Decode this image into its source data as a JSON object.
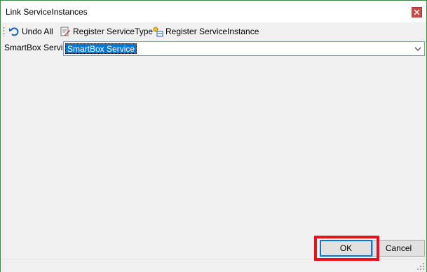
{
  "window": {
    "title": "Link ServiceInstances"
  },
  "icons": {
    "close": "close-icon",
    "undo": "undo-icon",
    "register_type": "register-service-type-icon",
    "register_instance": "register-service-instance-icon",
    "dropdown": "chevron-down-icon",
    "size_grip": "size-grip-icon"
  },
  "toolbar": {
    "undo_all": "Undo All",
    "register_service_type": "Register ServiceType",
    "register_service_instance": "Register ServiceInstance"
  },
  "form": {
    "service_label": "SmartBox Service",
    "service_value": "SmartBox Service"
  },
  "buttons": {
    "ok": "OK",
    "cancel": "Cancel"
  },
  "colors": {
    "highlight": "#e2141e",
    "selection": "#0078d7",
    "close_button": "#c94a4a",
    "window_border": "#3c8a3c"
  }
}
